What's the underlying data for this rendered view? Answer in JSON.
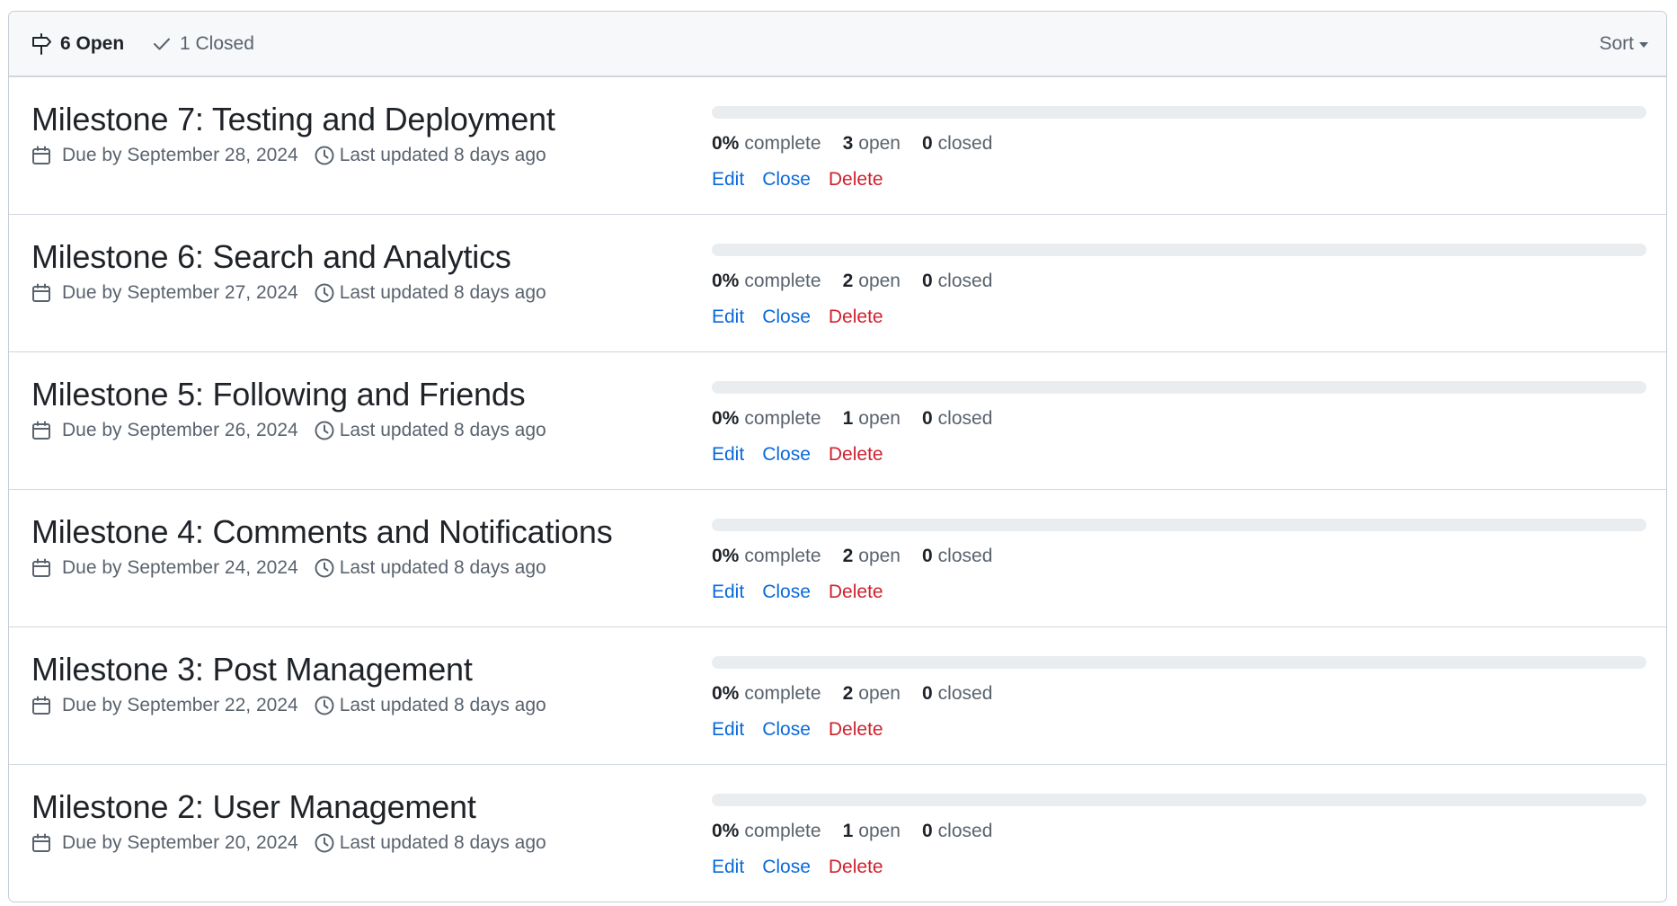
{
  "header": {
    "open_label": "6 Open",
    "closed_label": "1 Closed",
    "sort_label": "Sort"
  },
  "labels": {
    "complete": "complete",
    "open": "open",
    "closed": "closed",
    "edit": "Edit",
    "close": "Close",
    "delete": "Delete"
  },
  "colors": {
    "link": "#0969da",
    "danger": "#cf222e",
    "progress_track": "#eaedf0"
  },
  "milestones": [
    {
      "title": "Milestone 7: Testing and Deployment",
      "due": "Due by September 28, 2024",
      "updated": "Last updated 8 days ago",
      "percent": "0%",
      "progress": 0,
      "open_count": "3",
      "closed_count": "0"
    },
    {
      "title": "Milestone 6: Search and Analytics",
      "due": "Due by September 27, 2024",
      "updated": "Last updated 8 days ago",
      "percent": "0%",
      "progress": 0,
      "open_count": "2",
      "closed_count": "0"
    },
    {
      "title": "Milestone 5: Following and Friends",
      "due": "Due by September 26, 2024",
      "updated": "Last updated 8 days ago",
      "percent": "0%",
      "progress": 0,
      "open_count": "1",
      "closed_count": "0"
    },
    {
      "title": "Milestone 4: Comments and Notifications",
      "due": "Due by September 24, 2024",
      "updated": "Last updated 8 days ago",
      "percent": "0%",
      "progress": 0,
      "open_count": "2",
      "closed_count": "0"
    },
    {
      "title": "Milestone 3: Post Management",
      "due": "Due by September 22, 2024",
      "updated": "Last updated 8 days ago",
      "percent": "0%",
      "progress": 0,
      "open_count": "2",
      "closed_count": "0"
    },
    {
      "title": "Milestone 2: User Management",
      "due": "Due by September 20, 2024",
      "updated": "Last updated 8 days ago",
      "percent": "0%",
      "progress": 0,
      "open_count": "1",
      "closed_count": "0"
    }
  ]
}
